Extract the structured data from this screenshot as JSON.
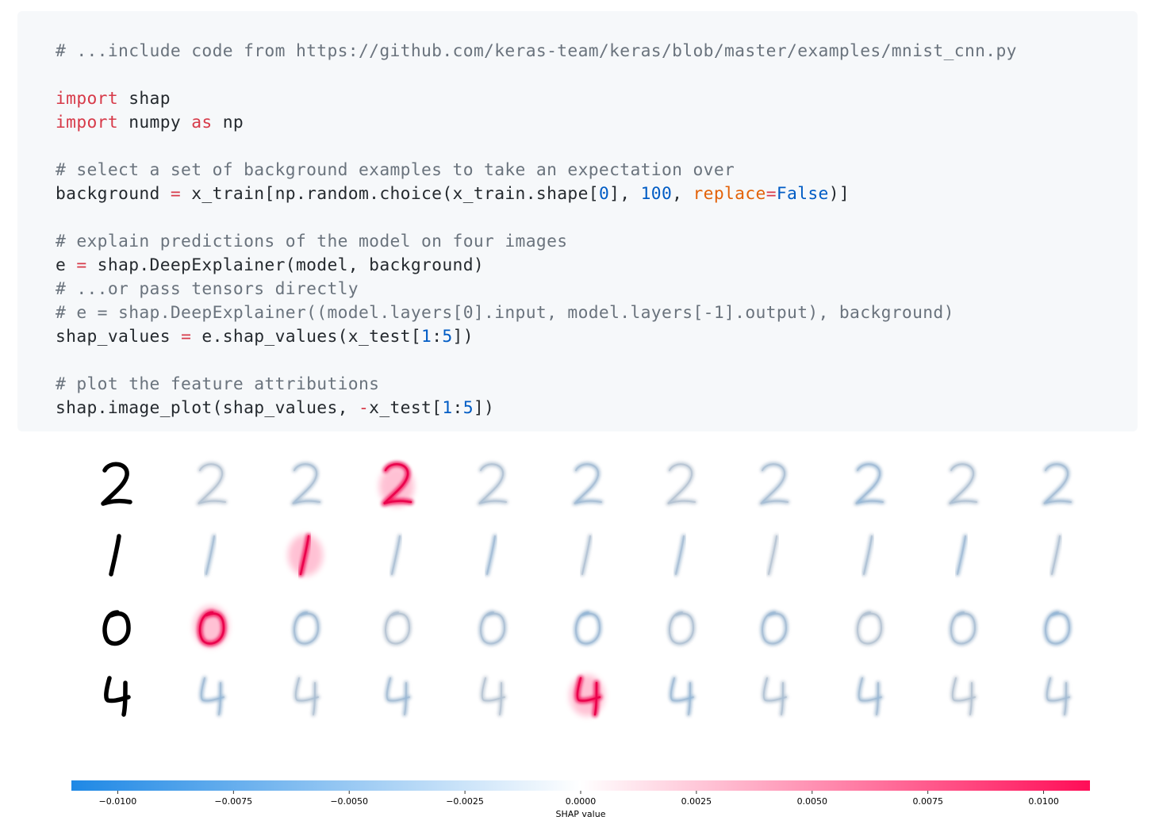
{
  "code": {
    "lines": [
      [
        {
          "t": "# ...include code from https://github.com/keras-team/keras/blob/master/examples/mnist_cnn.py",
          "c": "comment"
        }
      ],
      [],
      [
        {
          "t": "import",
          "c": "keyword"
        },
        {
          "t": " shap",
          "c": ""
        }
      ],
      [
        {
          "t": "import",
          "c": "keyword"
        },
        {
          "t": " numpy ",
          "c": ""
        },
        {
          "t": "as",
          "c": "keyword"
        },
        {
          "t": " np",
          "c": ""
        }
      ],
      [],
      [
        {
          "t": "# select a set of background examples to take an expectation over",
          "c": "comment"
        }
      ],
      [
        {
          "t": "background ",
          "c": ""
        },
        {
          "t": "=",
          "c": "keyword"
        },
        {
          "t": " x_train[np.random.choice(x_train.shape[",
          "c": ""
        },
        {
          "t": "0",
          "c": "number"
        },
        {
          "t": "], ",
          "c": ""
        },
        {
          "t": "100",
          "c": "number"
        },
        {
          "t": ", ",
          "c": ""
        },
        {
          "t": "replace",
          "c": "param"
        },
        {
          "t": "=",
          "c": "keyword"
        },
        {
          "t": "False",
          "c": "number"
        },
        {
          "t": ")]",
          "c": ""
        }
      ],
      [],
      [
        {
          "t": "# explain predictions of the model on four images",
          "c": "comment"
        }
      ],
      [
        {
          "t": "e ",
          "c": ""
        },
        {
          "t": "=",
          "c": "keyword"
        },
        {
          "t": " shap.DeepExplainer(model, background)",
          "c": ""
        }
      ],
      [
        {
          "t": "# ...or pass tensors directly",
          "c": "comment"
        }
      ],
      [
        {
          "t": "# e = shap.DeepExplainer((model.layers[0].input, model.layers[-1].output), background)",
          "c": "comment"
        }
      ],
      [
        {
          "t": "shap_values ",
          "c": ""
        },
        {
          "t": "=",
          "c": "keyword"
        },
        {
          "t": " e.shap_values(x_test[",
          "c": ""
        },
        {
          "t": "1",
          "c": "number"
        },
        {
          "t": ":",
          "c": ""
        },
        {
          "t": "5",
          "c": "number"
        },
        {
          "t": "])",
          "c": ""
        }
      ],
      [],
      [
        {
          "t": "# plot the feature attributions",
          "c": "comment"
        }
      ],
      [
        {
          "t": "shap.image_plot(shap_values, ",
          "c": ""
        },
        {
          "t": "-",
          "c": "keyword"
        },
        {
          "t": "x_test[",
          "c": ""
        },
        {
          "t": "1",
          "c": "number"
        },
        {
          "t": ":",
          "c": ""
        },
        {
          "t": "5",
          "c": "number"
        },
        {
          "t": "])",
          "c": ""
        }
      ]
    ],
    "colors": {
      "text": "#24292e",
      "comment": "#6a737d",
      "keyword": "#d73a49",
      "number": "#005cc5",
      "param": "#e36209",
      "background": "#f6f8fa"
    }
  },
  "shap_plot": {
    "digits": [
      "2",
      "1",
      "0",
      "4"
    ],
    "num_classes": 10,
    "highlight_class": [
      2,
      1,
      0,
      4
    ],
    "colorbar": {
      "min": -0.011,
      "max": 0.011,
      "ticks": [
        "−0.0100",
        "−0.0075",
        "−0.0050",
        "−0.0025",
        "0.0000",
        "0.0025",
        "0.0050",
        "0.0075",
        "0.0100"
      ],
      "tick_values": [
        -0.01,
        -0.0075,
        -0.005,
        -0.0025,
        0,
        0.0025,
        0.005,
        0.0075,
        0.01
      ],
      "label": "SHAP value",
      "neg_color": "#1e88e5",
      "pos_color": "#ff0d57"
    }
  }
}
